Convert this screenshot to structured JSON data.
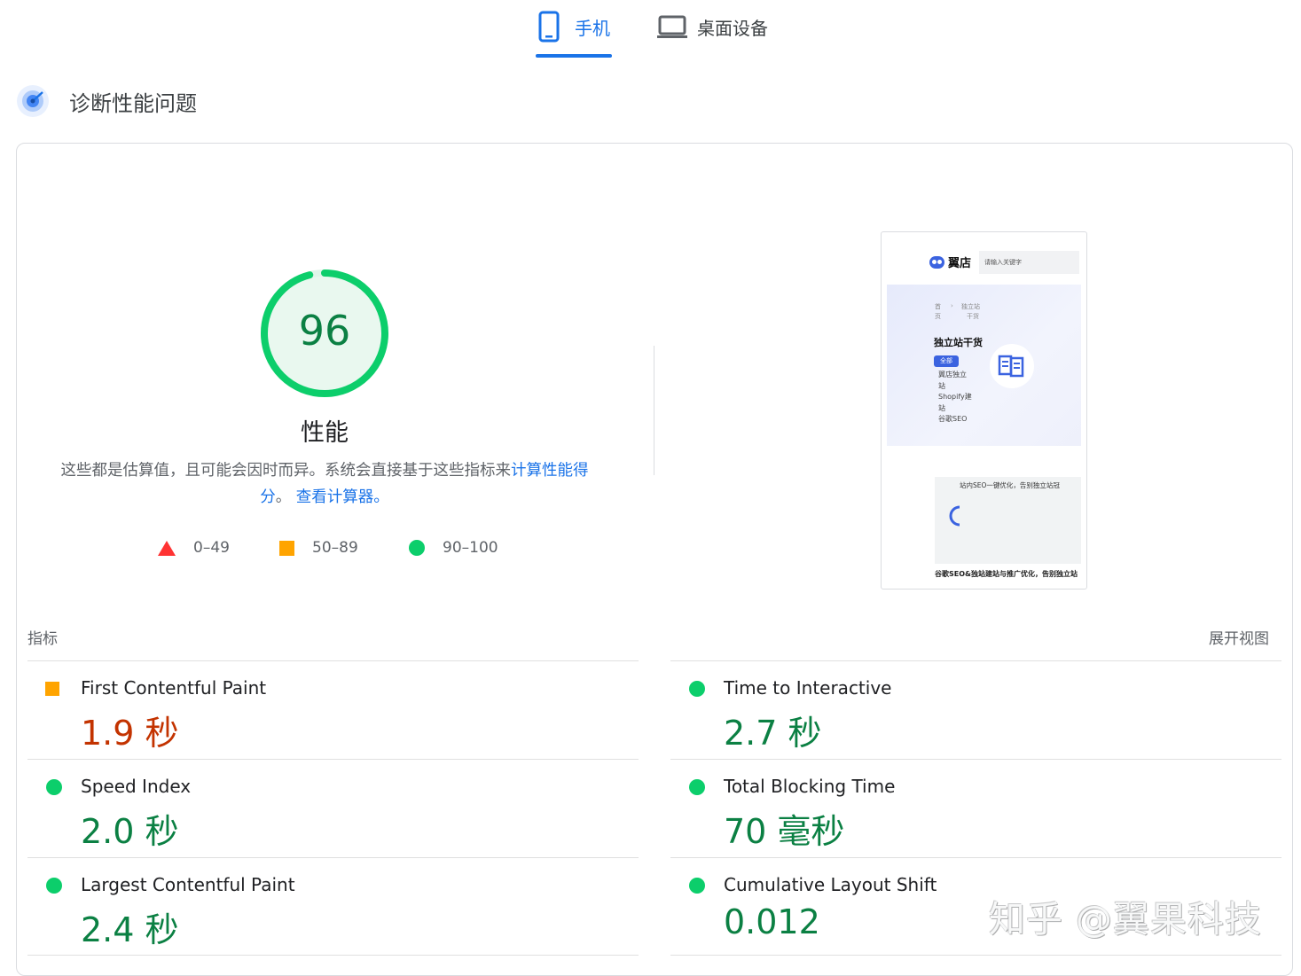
{
  "tabs": {
    "mobile_label": "手机",
    "desktop_label": "桌面设备",
    "active": "mobile"
  },
  "section": {
    "title": "诊断性能问题"
  },
  "gauge": {
    "score": "96",
    "score_value": 96,
    "label": "性能",
    "description_prefix": "这些都是估算值，且可能会因时而异。系统会直接基于这些指标来",
    "link_calc_score": "计算性能得分",
    "description_mid": "。",
    "link_calculator": "查看计算器。",
    "color": "#0cce6b"
  },
  "legend": {
    "fail": "0–49",
    "average": "50–89",
    "pass": "90–100"
  },
  "thumbnail": {
    "logo_text": "翼店",
    "search_placeholder": "请输入关键字",
    "breadcrumb_1a": "首",
    "breadcrumb_1b": "页",
    "breadcrumb_2a": "独立站",
    "breadcrumb_2b": "干货",
    "hero_title": "独立站干货",
    "chip": "全部",
    "menu": [
      "翼店独立",
      "站",
      "Shopify建",
      "站",
      "谷歌SEO"
    ],
    "image_alt": "站内SEO一键优化，告别独立站冠",
    "footer_text": "谷歌SEO&独站建站与推广优化，告别独立站"
  },
  "metrics": {
    "header": "指标",
    "toggle": "展开视图",
    "items": [
      {
        "title": "First Contentful Paint",
        "value": "1.9 秒",
        "status": "average"
      },
      {
        "title": "Time to Interactive",
        "value": "2.7 秒",
        "status": "pass"
      },
      {
        "title": "Speed Index",
        "value": "2.0 秒",
        "status": "pass"
      },
      {
        "title": "Total Blocking Time",
        "value": "70 毫秒",
        "status": "pass"
      },
      {
        "title": "Largest Contentful Paint",
        "value": "2.4 秒",
        "status": "pass"
      },
      {
        "title": "Cumulative Layout Shift",
        "value": "0.012",
        "status": "pass"
      }
    ]
  },
  "watermark": "知乎 @翼果科技",
  "colors": {
    "accent": "#1a73e8",
    "pass": "#0cce6b",
    "pass_text": "#0b8043",
    "average": "#ffa400",
    "average_text": "#c33300",
    "fail": "#ff3333"
  }
}
